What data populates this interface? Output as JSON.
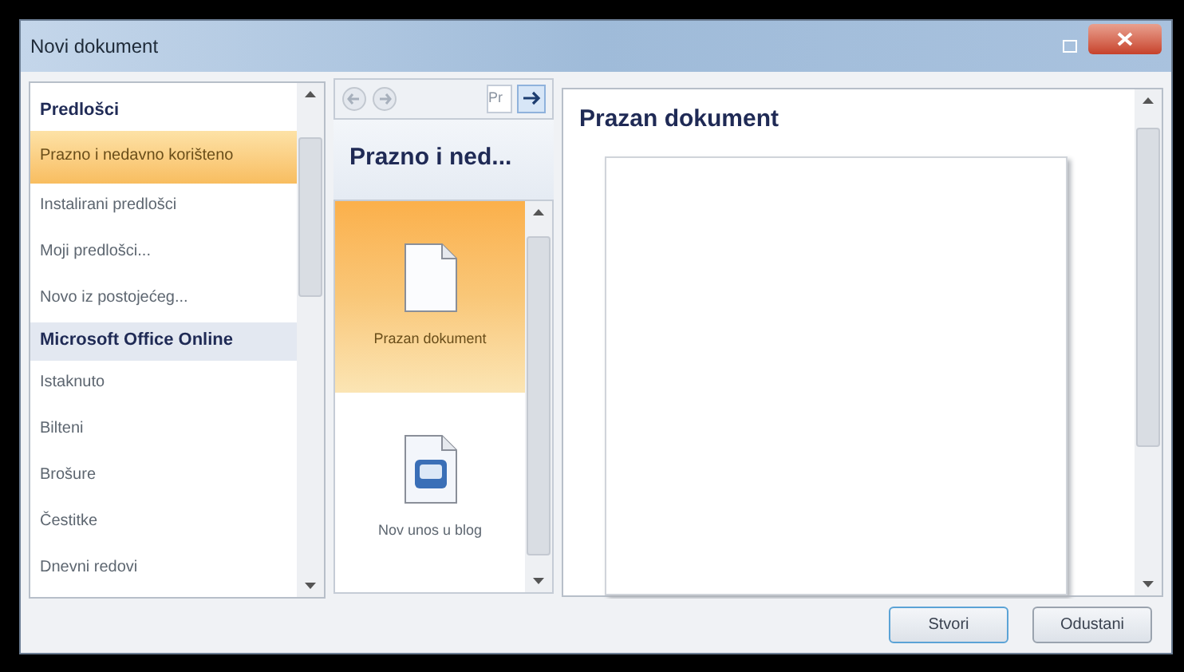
{
  "window": {
    "title": "Novi dokument"
  },
  "categories": [
    {
      "label": "Predlošci",
      "kind": "header",
      "selected": false
    },
    {
      "label": "Prazno i nedavno korišteno",
      "kind": "item",
      "selected": true
    },
    {
      "label": "Instalirani predlošci",
      "kind": "item",
      "selected": false
    },
    {
      "label": "Moji predlošci...",
      "kind": "item",
      "selected": false
    },
    {
      "label": "Novo iz postojećeg...",
      "kind": "item",
      "selected": false
    },
    {
      "label": "Microsoft Office Online",
      "kind": "header",
      "selected": false
    },
    {
      "label": "Istaknuto",
      "kind": "item",
      "selected": false
    },
    {
      "label": "Bilteni",
      "kind": "item",
      "selected": false
    },
    {
      "label": "Brošure",
      "kind": "item",
      "selected": false
    },
    {
      "label": "Čestitke",
      "kind": "item",
      "selected": false
    },
    {
      "label": "Dnevni redovi",
      "kind": "item",
      "selected": false
    }
  ],
  "templates_panel": {
    "search_value": "Pr",
    "heading": "Prazno i ned...",
    "templates": [
      {
        "label": "Prazan dokument",
        "kind": "blank",
        "selected": true
      },
      {
        "label": "Nov unos u blog",
        "kind": "blog",
        "selected": false
      }
    ]
  },
  "preview": {
    "title": "Prazan dokument"
  },
  "buttons": [
    "Stvori",
    "Odustani"
  ]
}
